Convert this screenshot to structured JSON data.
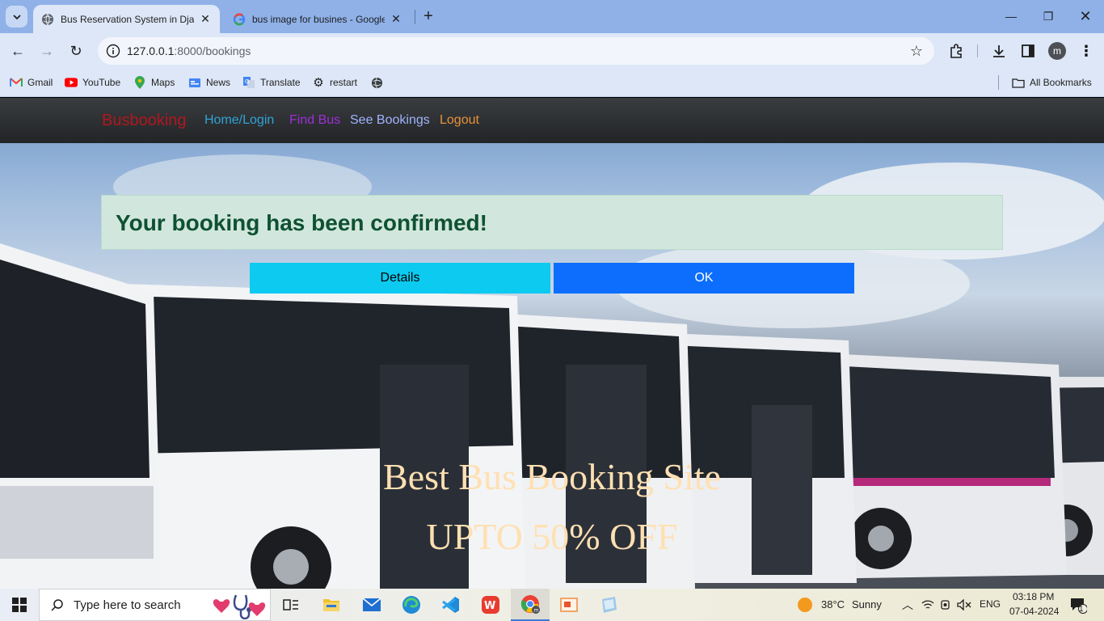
{
  "browser": {
    "tabs": [
      {
        "title": "Bus Reservation System in Djan",
        "active": true
      },
      {
        "title": "bus image for busines - Google",
        "active": false
      }
    ],
    "url_host": "127.0.0.1",
    "url_path": ":8000/bookings",
    "bookmarks": [
      "Gmail",
      "YouTube",
      "Maps",
      "News",
      "Translate",
      "restart"
    ],
    "all_bookmarks": "All Bookmarks",
    "profile_initial": "m"
  },
  "navbar": {
    "brand": "Busbooking",
    "links": [
      {
        "label": "Home/Login",
        "color": "#2fa4d8"
      },
      {
        "label": "Find Bus",
        "color": "#9b2fd6"
      },
      {
        "label": "See Bookings",
        "color": "#9fb4ff"
      },
      {
        "label": "Logout",
        "color": "#e8923a"
      }
    ]
  },
  "alert": {
    "message": "Your booking has been confirmed!"
  },
  "buttons": {
    "details": "Details",
    "ok": "OK"
  },
  "promo": {
    "line1": "Best Bus Booking Site",
    "line2": "UPTO 50% OFF"
  },
  "taskbar": {
    "search_placeholder": "Type here to search",
    "weather_temp": "38°C",
    "weather_text": "Sunny",
    "language": "ENG",
    "time": "03:18 PM",
    "date": "07-04-2024",
    "notifications": "1"
  }
}
